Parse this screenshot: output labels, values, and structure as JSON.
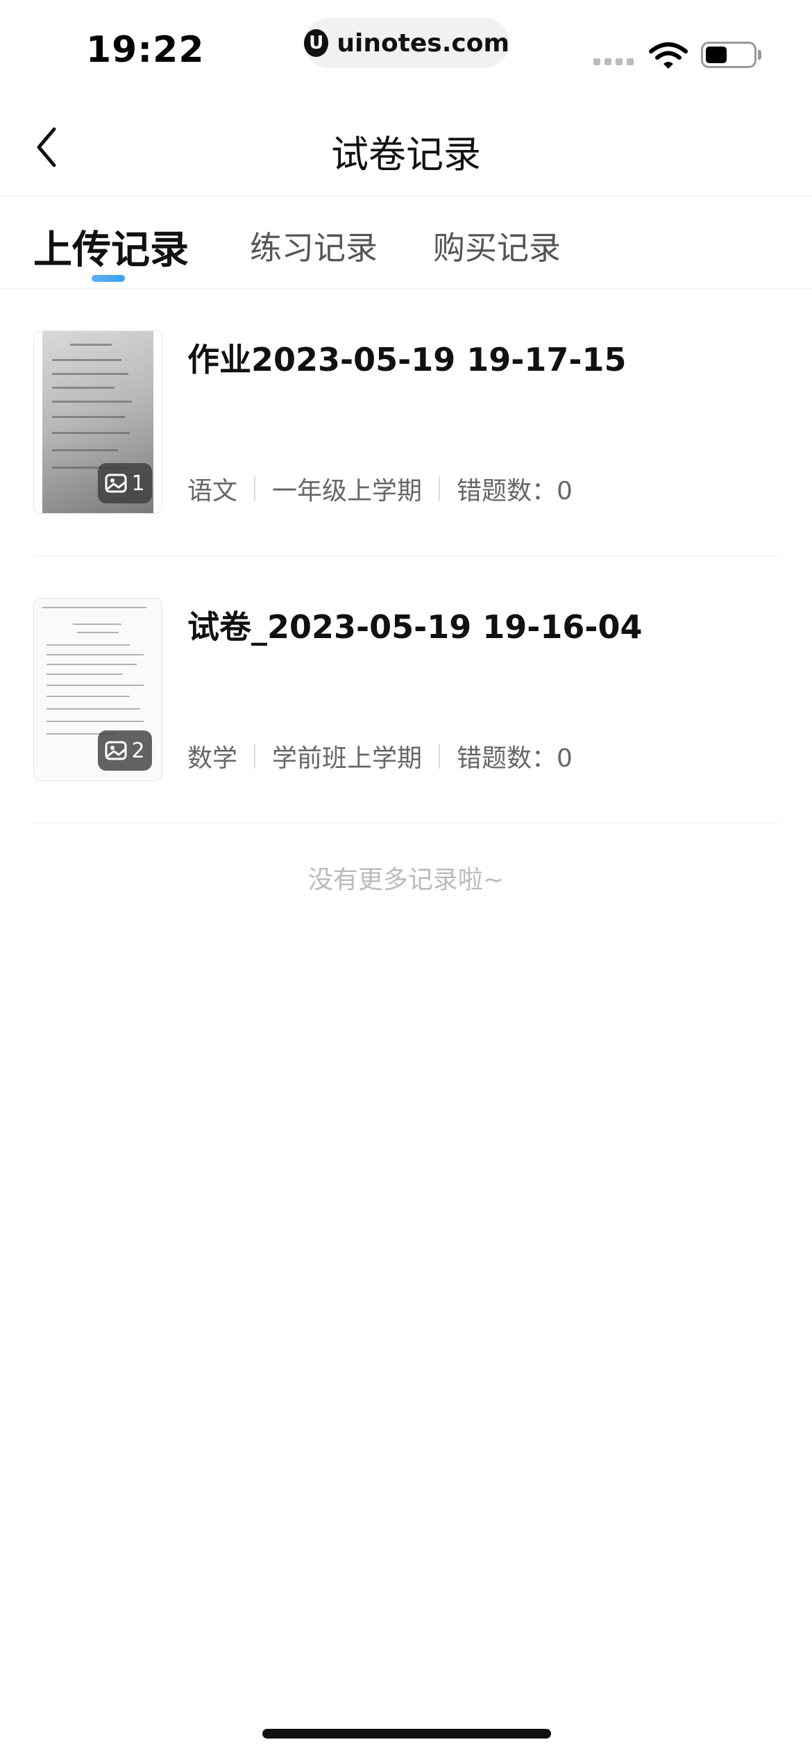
{
  "status_bar": {
    "time": "19:22",
    "url": "uinotes.com",
    "battery_level": 0.45
  },
  "nav": {
    "title": "试卷记录",
    "back_icon": "chevron-left-icon"
  },
  "tabs": [
    {
      "label": "上传记录",
      "active": true
    },
    {
      "label": "练习记录",
      "active": false
    },
    {
      "label": "购买记录",
      "active": false
    }
  ],
  "records": [
    {
      "title": "作业2023-05-19 19-17-15",
      "image_count": "1",
      "subject": "语文",
      "grade": "一年级上学期",
      "errors": "错题数：0"
    },
    {
      "title": "试卷_2023-05-19 19-16-04",
      "image_count": "2",
      "subject": "数学",
      "grade": "学前班上学期",
      "errors": "错题数：0"
    }
  ],
  "footer": {
    "no_more": "没有更多记录啦~"
  },
  "colors": {
    "accent": "#3aa0ee",
    "text_primary": "#111111",
    "text_secondary": "#666666"
  }
}
